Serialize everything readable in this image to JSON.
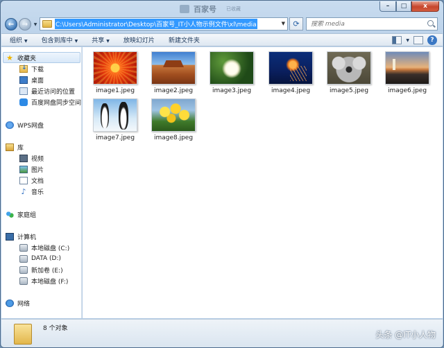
{
  "window": {
    "title_ghost": "百家号",
    "title_ghost_small": "已收藏",
    "controls": {
      "minimize": "–",
      "maximize": "□",
      "close": "x"
    }
  },
  "addressbar": {
    "path": "C:\\Users\\Administrator\\Desktop\\百家号_IT小人物示例文件\\xl\\media",
    "search_placeholder": "搜索 media"
  },
  "toolbar": {
    "items": [
      "组织",
      "包含到库中",
      "共享",
      "放映幻灯片",
      "新建文件夹"
    ]
  },
  "navpane": {
    "favorites": {
      "label": "收藏夹",
      "items": [
        "下载",
        "桌面",
        "最近访问的位置",
        "百度网盘同步空间"
      ]
    },
    "wps": {
      "label": "WPS网盘"
    },
    "libraries": {
      "label": "库",
      "items": [
        "视频",
        "图片",
        "文档",
        "音乐"
      ]
    },
    "homegroup": {
      "label": "家庭组"
    },
    "computer": {
      "label": "计算机",
      "items": [
        "本地磁盘 (C:)",
        "DATA (D:)",
        "新加卷 (E:)",
        "本地磁盘 (F:)"
      ]
    },
    "network": {
      "label": "网络"
    }
  },
  "files": [
    {
      "name": "image1.jpeg"
    },
    {
      "name": "image2.jpeg"
    },
    {
      "name": "image3.jpeg"
    },
    {
      "name": "image4.jpeg"
    },
    {
      "name": "image5.jpeg"
    },
    {
      "name": "image6.jpeg"
    },
    {
      "name": "image7.jpeg"
    },
    {
      "name": "image8.jpeg"
    }
  ],
  "status": {
    "count_text": "8 个对象",
    "watermark": "头条 @IT小人物"
  }
}
